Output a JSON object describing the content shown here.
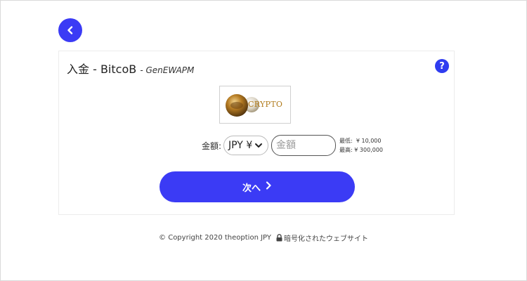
{
  "header": {
    "back_icon": "chevron-left-icon"
  },
  "card": {
    "title": "入金 - BitcoB",
    "subtitle": "- GenEWAPM",
    "help_label": "?",
    "logo_text": "CRYPTO"
  },
  "form": {
    "amount_label": "金額:",
    "currency_selected": "JPY ¥",
    "amount_value": "",
    "amount_placeholder": "金額",
    "min_label": "最低:",
    "min_value": "¥ 10,000",
    "max_label": "最高:",
    "max_value": "¥ 300,000"
  },
  "actions": {
    "next_label": "次へ"
  },
  "footer": {
    "copyright": "© Copyright 2020 theoption JPY",
    "secure_text": "暗号化されたウェブサイト"
  },
  "colors": {
    "primary": "#3b3bf5",
    "help": "#2f3cf0",
    "logo_gold": "#b07a1a"
  }
}
